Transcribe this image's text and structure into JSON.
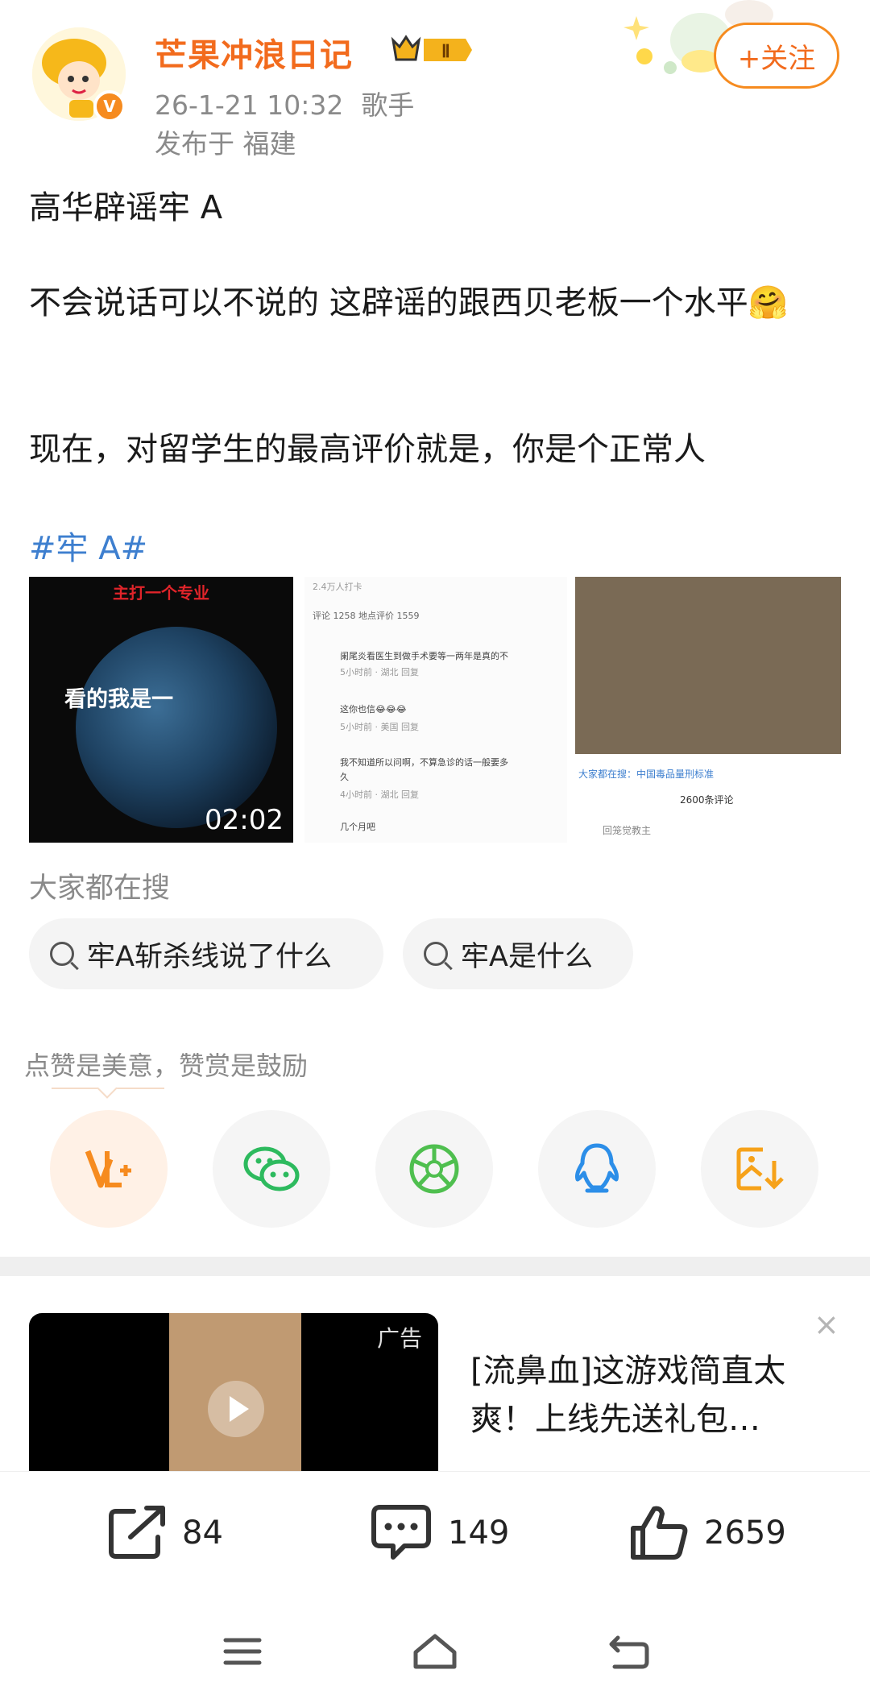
{
  "post": {
    "username": "芒果冲浪日记",
    "level_badge": "Ⅱ",
    "timestamp": "26-1-21 10:32",
    "source": "歌手",
    "location": "发布于 福建",
    "follow_label": "+关注",
    "paragraphs": [
      "高华辟谣牢 A",
      "不会说话可以不说的 这辟谣的跟西贝老板一个水平🤗",
      "现在，对留学生的最高评价就是，你是个正常人"
    ],
    "hashtag": "#牢 A#"
  },
  "media": [
    {
      "top_label": "主打一个专业",
      "overlay_text": "看的我是一",
      "duration": "02:02"
    },
    {
      "lines": [
        "2.4万人打卡",
        "评论 1258     地点评价 1559",
        "阑尾炎看医生到做手术要等一两年是真的不",
        "5小时前 · 湖北   回复",
        "这你也信😂😂😂",
        "5小时前 · 美国   回复",
        "我不知道所以问啊，不算急诊的话一般要多",
        "久",
        "4小时前 · 湖北   回复",
        "几个月吧"
      ]
    },
    {
      "search_hint": "大家都在搜：中国毒品量刑标准",
      "comments": "2600条评论",
      "author": "回笼觉教主"
    }
  ],
  "search": {
    "label": "大家都在搜",
    "chips": [
      "牢A斩杀线说了什么",
      "牢A是什么"
    ]
  },
  "reward": {
    "label": "点赞是美意，赞赏是鼓励",
    "share_icons": [
      "reward-icon",
      "wechat-icon",
      "moments-icon",
      "qq-icon",
      "save-image-icon"
    ]
  },
  "ad": {
    "tag": "广告",
    "text": "[流鼻血]这游戏简直太爽！上线先送礼包…",
    "close": "×"
  },
  "actions": {
    "repost_count": "84",
    "comment_count": "149",
    "like_count": "2659"
  },
  "colors": {
    "username": "#f26b1d",
    "follow_border": "#f68b1f",
    "hashtag": "#3e7fcf",
    "muted_text": "#8a8a8a"
  }
}
